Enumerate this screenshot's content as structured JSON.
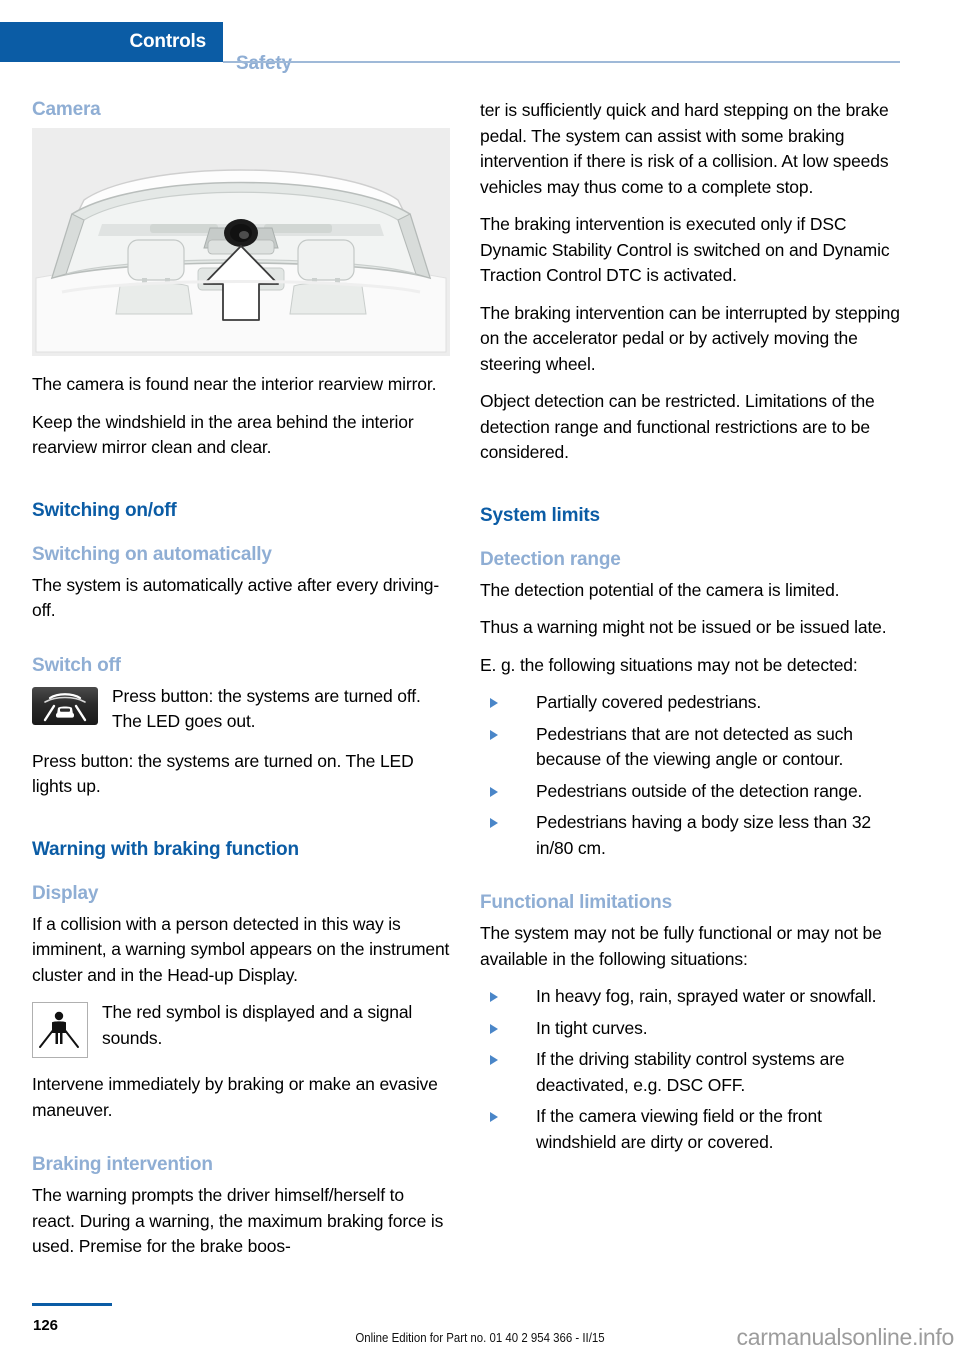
{
  "header": {
    "active_tab": "Controls",
    "inactive_tab": "Safety",
    "accent_color": "#0B5CA5",
    "muted_color": "#8FAED4"
  },
  "figure": {
    "alt": "car-interior-windshield-camera-illustration",
    "caption_parts": [
      "camera-dot",
      "up-arrow",
      "windshield",
      "headrests"
    ]
  },
  "left_column": {
    "heading_camera": "Camera",
    "p_camera_location": "The camera is found near the interior rearview mirror.",
    "p_keep_clean": "Keep the windshield in the area behind the interior rearview mirror clean and clear.",
    "heading_switching_onoff": "Switching on/off",
    "heading_switching_auto": "Switching on automatically",
    "p_auto_active": "The system is automatically active after every driving-off.",
    "heading_switch_off": "Switch off",
    "icon_switch_off_name": "lane-departure-button-icon",
    "p_switch_off_icon": "Press button: the systems are turned off. The LED goes out.",
    "p_switch_on": "Press button: the systems are turned on. The LED lights up.",
    "heading_warning_braking": "Warning with braking function",
    "heading_display": "Display",
    "p_display": "If a collision with a person detected in this way is imminent, a warning symbol appears on the instrument cluster and in the Head-up Display.",
    "icon_warning_name": "pedestrian-warning-symbol-icon",
    "p_red_symbol": "The red symbol is displayed and a signal sounds.",
    "p_intervene": "Intervene immediately by braking or make an evasive maneuver.",
    "heading_braking_intervention": "Braking intervention",
    "p_braking_prompt": "The warning prompts the driver himself/herself to react. During a warning, the maximum braking force is used. Premise for the brake boos-"
  },
  "right_column": {
    "p_continued": "ter is sufficiently quick and hard stepping on the brake pedal. The system can assist with some braking intervention if there is risk of a collision. At low speeds vehicles may thus come to a complete stop.",
    "p_dsc": "The braking intervention is executed only if DSC Dynamic Stability Control is switched on and Dynamic Traction Control DTC is activated.",
    "p_interrupt": "The braking intervention can be interrupted by stepping on the accelerator pedal or by actively moving the steering wheel.",
    "p_object_detection": "Object detection can be restricted. Limitations of the detection range and functional restrictions are to be considered.",
    "heading_system_limits": "System limits",
    "heading_detection_range": "Detection range",
    "p_detection_limited": "The detection potential of the camera is limited.",
    "p_warning_late": "Thus a warning might not be issued or be issued late.",
    "p_eg_situations": "E. g. the following situations may not be detected:",
    "detection_bullets": [
      "Partially covered pedestrians.",
      "Pedestrians that are not detected as such because of the viewing angle or contour.",
      "Pedestrians outside of the detection range.",
      "Pedestrians having a body size less than 32 in/80 cm."
    ],
    "heading_functional_limitations": "Functional limitations",
    "p_not_fully_functional": "The system may not be fully functional or may not be available in the following situations:",
    "limitation_bullets": [
      "In heavy fog, rain, sprayed water or snowfall.",
      "In tight curves.",
      "If the driving stability control systems are deactivated, e.g. DSC OFF.",
      "If the camera viewing field or the front windshield are dirty or covered."
    ]
  },
  "footer": {
    "page_number": "126",
    "edition_text": "Online Edition for Part no. 01 40 2 954 366 - II/15",
    "watermark": "carmanualsonline.info"
  }
}
